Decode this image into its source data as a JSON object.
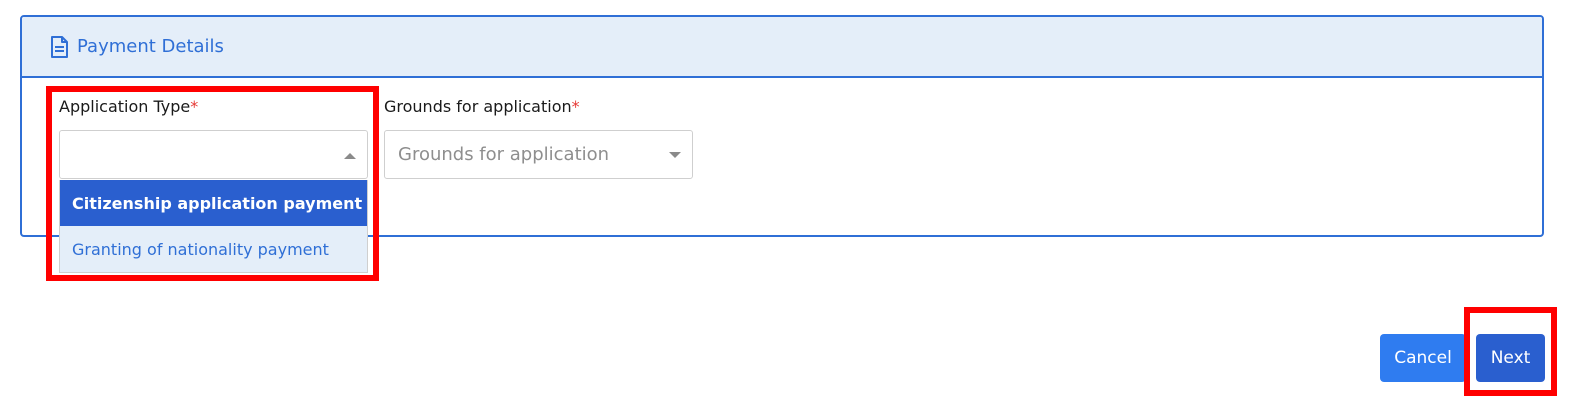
{
  "card": {
    "title": "Payment Details",
    "icon": "document-icon"
  },
  "fields": {
    "application_type": {
      "label": "Application Type",
      "required_mark": "*",
      "value": "",
      "options": [
        "Citizenship application payment",
        "Granting of nationality payment"
      ],
      "selected_index": 0
    },
    "grounds": {
      "label": "Grounds for application",
      "required_mark": "*",
      "placeholder": "Grounds for application"
    }
  },
  "buttons": {
    "cancel": "Cancel",
    "next": "Next"
  },
  "colors": {
    "accent": "#2f6fd6",
    "header_bg": "#e4eef9",
    "selected_option": "#2a5fcf",
    "cancel_button": "#2f7cf0",
    "next_button": "#2a5fcf",
    "highlight": "#ff0000",
    "required": "#e53935"
  }
}
